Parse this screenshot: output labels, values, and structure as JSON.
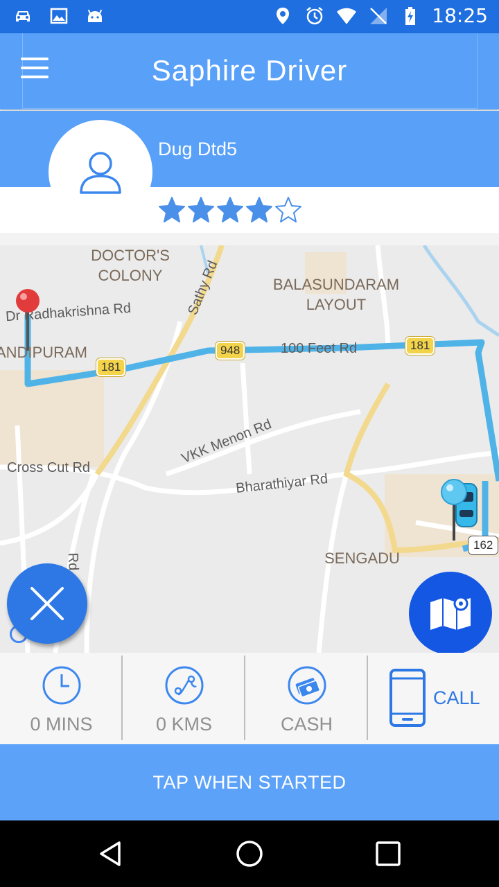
{
  "status_bar": {
    "time": "18:25",
    "left_icons": [
      "car-icon",
      "image-icon",
      "android-icon"
    ],
    "right_icons": [
      "location-icon",
      "alarm-icon",
      "wifi-icon",
      "no-sim-icon",
      "battery-charging-icon"
    ]
  },
  "app_bar": {
    "title": "Saphire Driver",
    "menu_icon": "hamburger-menu-icon"
  },
  "driver": {
    "name": "Dug Dtd5",
    "rating": 4,
    "rating_max": 5
  },
  "map": {
    "areas": [
      "DOCTOR'S COLONY",
      "BALASUNDARAM LAYOUT",
      "SENGADU",
      "ANDIPURAM"
    ],
    "roads": [
      "Dr Radhakrishna Rd",
      "Sathy Rd",
      "100 Feet Rd",
      "VKK Menon Rd",
      "Cross Cut Rd",
      "Bharathiyar Rd",
      "Rd"
    ],
    "shields": [
      "181",
      "948",
      "181",
      "162"
    ],
    "route_color": "#4fb3e8"
  },
  "info": {
    "time_value": "0 MINS",
    "distance_value": "0 KMS",
    "payment_value": "CASH",
    "call_label": "CALL"
  },
  "action": {
    "start_label": "TAP WHEN STARTED"
  },
  "colors": {
    "primary": "#58a0f8",
    "accent": "#2d78e5",
    "status_bar": "#1f6fe0"
  }
}
